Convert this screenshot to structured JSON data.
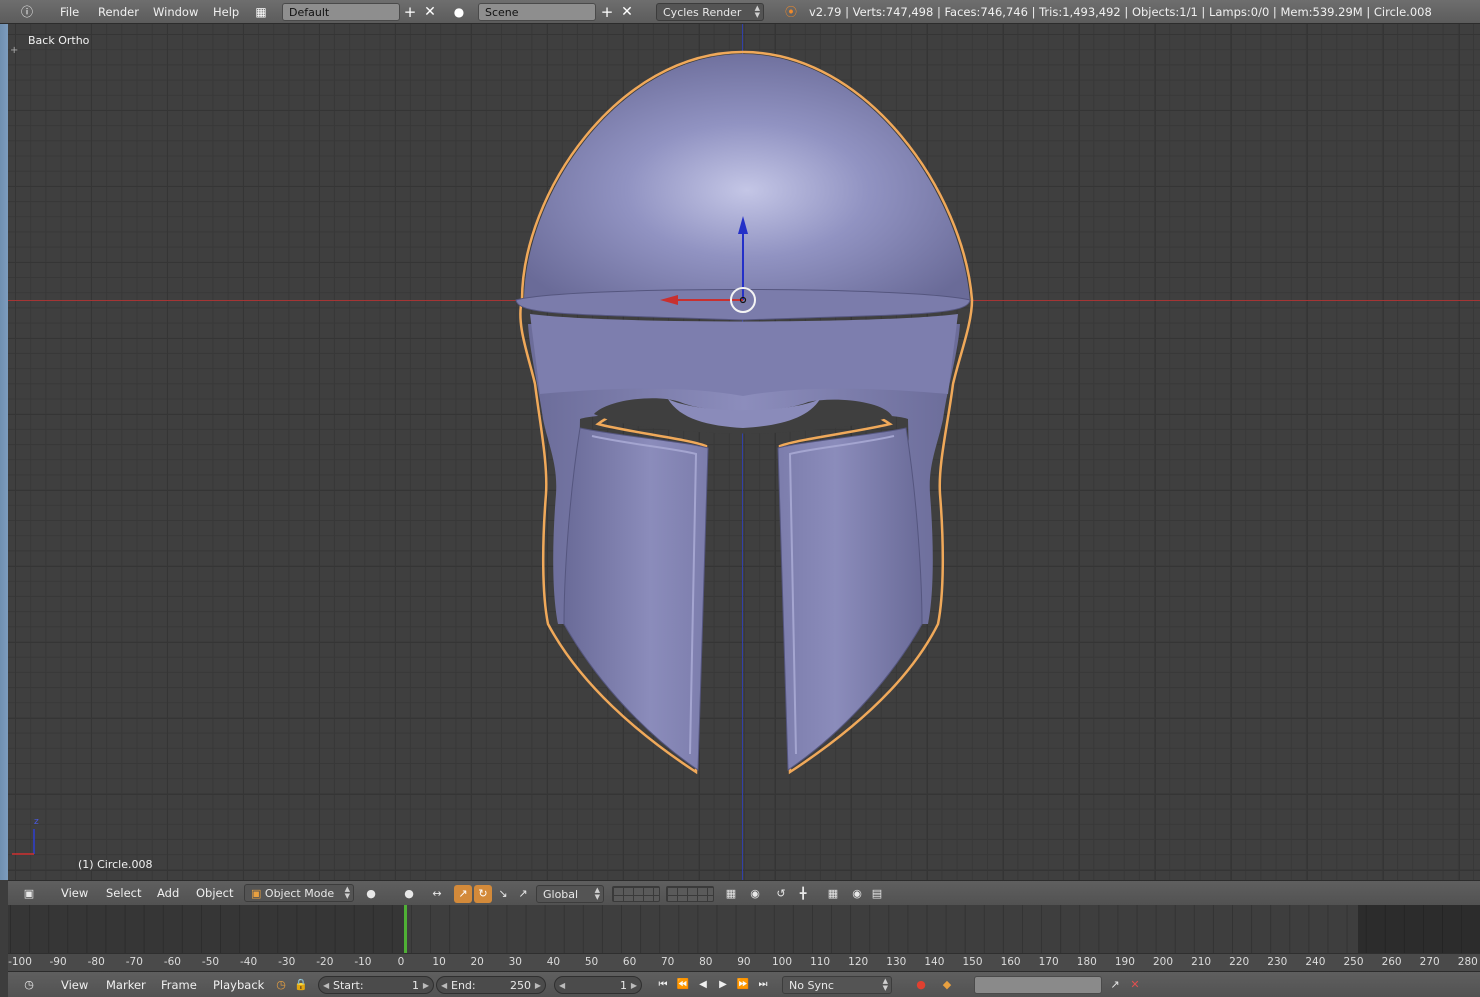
{
  "top_header": {
    "menu": [
      "File",
      "Render",
      "Window",
      "Help"
    ],
    "layout": "Default",
    "scene": "Scene",
    "engine": "Cycles Render",
    "stats": "v2.79 | Verts:747,498 | Faces:746,746 | Tris:1,493,492 | Objects:1/1 | Lamps:0/0 | Mem:539.29M | Circle.008"
  },
  "viewport": {
    "view_label": "Back Ortho",
    "object_label": "(1) Circle.008",
    "object_color": "#8a8cb8",
    "outline_color": "#f0a95a"
  },
  "view_header": {
    "menu": [
      "View",
      "Select",
      "Add",
      "Object"
    ],
    "mode": "Object Mode",
    "orientation": "Global"
  },
  "timeline": {
    "ticks": [
      "-100",
      "-90",
      "-80",
      "-70",
      "-60",
      "-50",
      "-40",
      "-30",
      "-20",
      "-10",
      "0",
      "10",
      "20",
      "30",
      "40",
      "50",
      "60",
      "70",
      "80",
      "90",
      "100",
      "110",
      "120",
      "130",
      "140",
      "150",
      "160",
      "170",
      "180",
      "190",
      "200",
      "210",
      "220",
      "230",
      "240",
      "250",
      "260",
      "270",
      "280"
    ],
    "current_frame": 1
  },
  "timeline_header": {
    "menu": [
      "View",
      "Marker",
      "Frame",
      "Playback"
    ],
    "start_label": "Start:",
    "start_value": "1",
    "end_label": "End:",
    "end_value": "250",
    "current_value": "1",
    "sync": "No Sync"
  }
}
